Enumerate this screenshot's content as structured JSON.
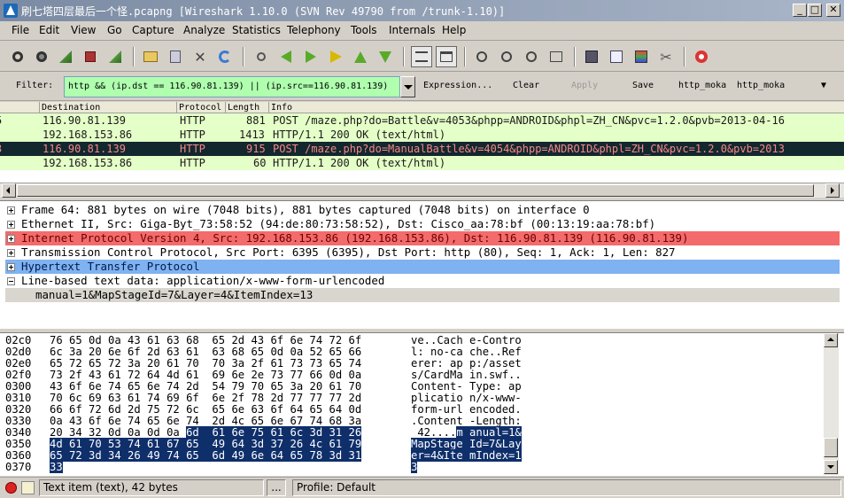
{
  "window": {
    "title": "刷七塔四层最后一个怪.pcapng   [Wireshark 1.10.0  (SVN Rev 49790 from /trunk-1.10)]",
    "buttons": {
      "minimize": "_",
      "maximize": "□",
      "close": "✕"
    }
  },
  "menu": [
    "File",
    "Edit",
    "View",
    "Go",
    "Capture",
    "Analyze",
    "Statistics",
    "Telephony",
    "Tools",
    "Internals",
    "Help"
  ],
  "toolbar": {
    "icons": [
      "interfaces-icon",
      "options-icon",
      "start-capture-icon",
      "stop-capture-icon",
      "restart-capture-icon",
      "open-file-icon",
      "save-file-icon",
      "close-file-icon",
      "reload-icon",
      "find-packet-icon",
      "go-back-icon",
      "go-forward-icon",
      "go-to-packet-icon",
      "go-first-icon",
      "go-last-icon",
      "colorize-icon",
      "auto-scroll-icon",
      "zoom-in-icon",
      "zoom-out-icon",
      "normal-size-icon",
      "resize-columns-icon",
      "capture-filters-icon",
      "display-filters-icon",
      "coloring-rules-icon",
      "preferences-icon",
      "help-icon"
    ]
  },
  "filter": {
    "label": "Filter:",
    "value": "http && (ip.dst == 116.90.81.139) || (ip.src==116.90.81.139)",
    "expression": "Expression...",
    "clear": "Clear",
    "apply": "Apply",
    "save": "Save",
    "bookmark1": "http_moka",
    "bookmark2": "http_moka",
    "bg_color": "#afffaf"
  },
  "packet_list": {
    "columns": [
      "Destination",
      "Protocol",
      "Length",
      "Info"
    ],
    "rows": [
      {
        "no": "5",
        "dst": "116.90.81.139",
        "proto": "HTTP",
        "len": "881",
        "info": "POST /maze.php?do=Battle&v=4053&phpp=ANDROID&phpl=ZH_CN&pvc=1.2.0&pvb=2013-04-16",
        "style": "http-req"
      },
      {
        "no": "",
        "dst": "192.168.153.86",
        "proto": "HTTP",
        "len": "1413",
        "info": "HTTP/1.1 200 OK  (text/html)",
        "style": "http-req"
      },
      {
        "no": "3",
        "dst": "116.90.81.139",
        "proto": "HTTP",
        "len": "915",
        "info": "POST /maze.php?do=ManualBattle&v=4054&phpp=ANDROID&phpl=ZH_CN&pvc=1.2.0&pvb=2013",
        "style": "sel"
      },
      {
        "no": "",
        "dst": "192.168.153.86",
        "proto": "HTTP",
        "len": "60",
        "info": "HTTP/1.1 200 OK  (text/html)",
        "style": "http-req"
      }
    ]
  },
  "details": [
    {
      "text": "Frame 64: 881 bytes on wire (7048 bits), 881 bytes captured (7048 bits) on interface 0",
      "style": "",
      "expander": "plus"
    },
    {
      "text": "Ethernet II, Src: Giga-Byt_73:58:52 (94:de:80:73:58:52), Dst: Cisco_aa:78:bf (00:13:19:aa:78:bf)",
      "style": "",
      "expander": "plus"
    },
    {
      "text": "Internet Protocol Version 4, Src: 192.168.153.86 (192.168.153.86), Dst: 116.90.81.139 (116.90.81.139)",
      "style": "ip",
      "expander": "plus"
    },
    {
      "text": "Transmission Control Protocol, Src Port: 6395 (6395), Dst Port: http (80), Seq: 1, Ack: 1, Len: 827",
      "style": "",
      "expander": "plus"
    },
    {
      "text": "Hypertext Transfer Protocol",
      "style": "httpsel",
      "expander": "plus"
    },
    {
      "text": "Line-based text data: application/x-www-form-urlencoded",
      "style": "",
      "expander": "minus"
    },
    {
      "text": "manual=1&MapStageId=7&Layer=4&ItemIndex=13",
      "style": "sub",
      "expander": "none"
    }
  ],
  "hex": [
    {
      "off": "02c0",
      "hex": "76 65 0d 0a 43 61 63 68  65 2d 43 6f 6e 74 72 6f",
      "ascii": "ve..Cach e-Contro",
      "sel_from": -1
    },
    {
      "off": "02d0",
      "hex": "6c 3a 20 6e 6f 2d 63 61  63 68 65 0d 0a 52 65 66",
      "ascii": "l: no-ca che..Ref",
      "sel_from": -1
    },
    {
      "off": "02e0",
      "hex": "65 72 65 72 3a 20 61 70  70 3a 2f 61 73 73 65 74",
      "ascii": "erer: ap p:/asset",
      "sel_from": -1
    },
    {
      "off": "02f0",
      "hex": "73 2f 43 61 72 64 4d 61  69 6e 2e 73 77 66 0d 0a",
      "ascii": "s/CardMa in.swf..",
      "sel_from": -1
    },
    {
      "off": "0300",
      "hex": "43 6f 6e 74 65 6e 74 2d  54 79 70 65 3a 20 61 70",
      "ascii": "Content- Type: ap",
      "sel_from": -1
    },
    {
      "off": "0310",
      "hex": "70 6c 69 63 61 74 69 6f  6e 2f 78 2d 77 77 77 2d",
      "ascii": "plicatio n/x-www-",
      "sel_from": -1
    },
    {
      "off": "0320",
      "hex": "66 6f 72 6d 2d 75 72 6c  65 6e 63 6f 64 65 64 0d",
      "ascii": "form-url encoded.",
      "sel_from": -1
    },
    {
      "off": "0330",
      "hex": "0a 43 6f 6e 74 65 6e 74  2d 4c 65 6e 67 74 68 3a",
      "ascii": ".Content -Length:",
      "sel_from": -1
    },
    {
      "off": "0340",
      "hex_plain": "20 34 32 0d 0a 0d 0a ",
      "hex_sel": "6d  61 6e 75 61 6c 3d 31 26",
      "ascii_plain": " 42....",
      "ascii_sel": "m anual=1&"
    },
    {
      "off": "0350",
      "hex_plain": "",
      "hex_sel": "4d 61 70 53 74 61 67 65  49 64 3d 37 26 4c 61 79",
      "ascii_plain": "",
      "ascii_sel": "MapStage Id=7&Lay"
    },
    {
      "off": "0360",
      "hex_plain": "",
      "hex_sel": "65 72 3d 34 26 49 74 65  6d 49 6e 64 65 78 3d 31",
      "ascii_plain": "",
      "ascii_sel": "er=4&Ite mIndex=1"
    },
    {
      "off": "0370",
      "hex_plain": "",
      "hex_sel": "33",
      "ascii_plain": "",
      "ascii_sel": "3"
    }
  ],
  "status": {
    "item": "Text item (text), 42 bytes",
    "ellipsis": "...",
    "profile": "Profile: Default"
  }
}
